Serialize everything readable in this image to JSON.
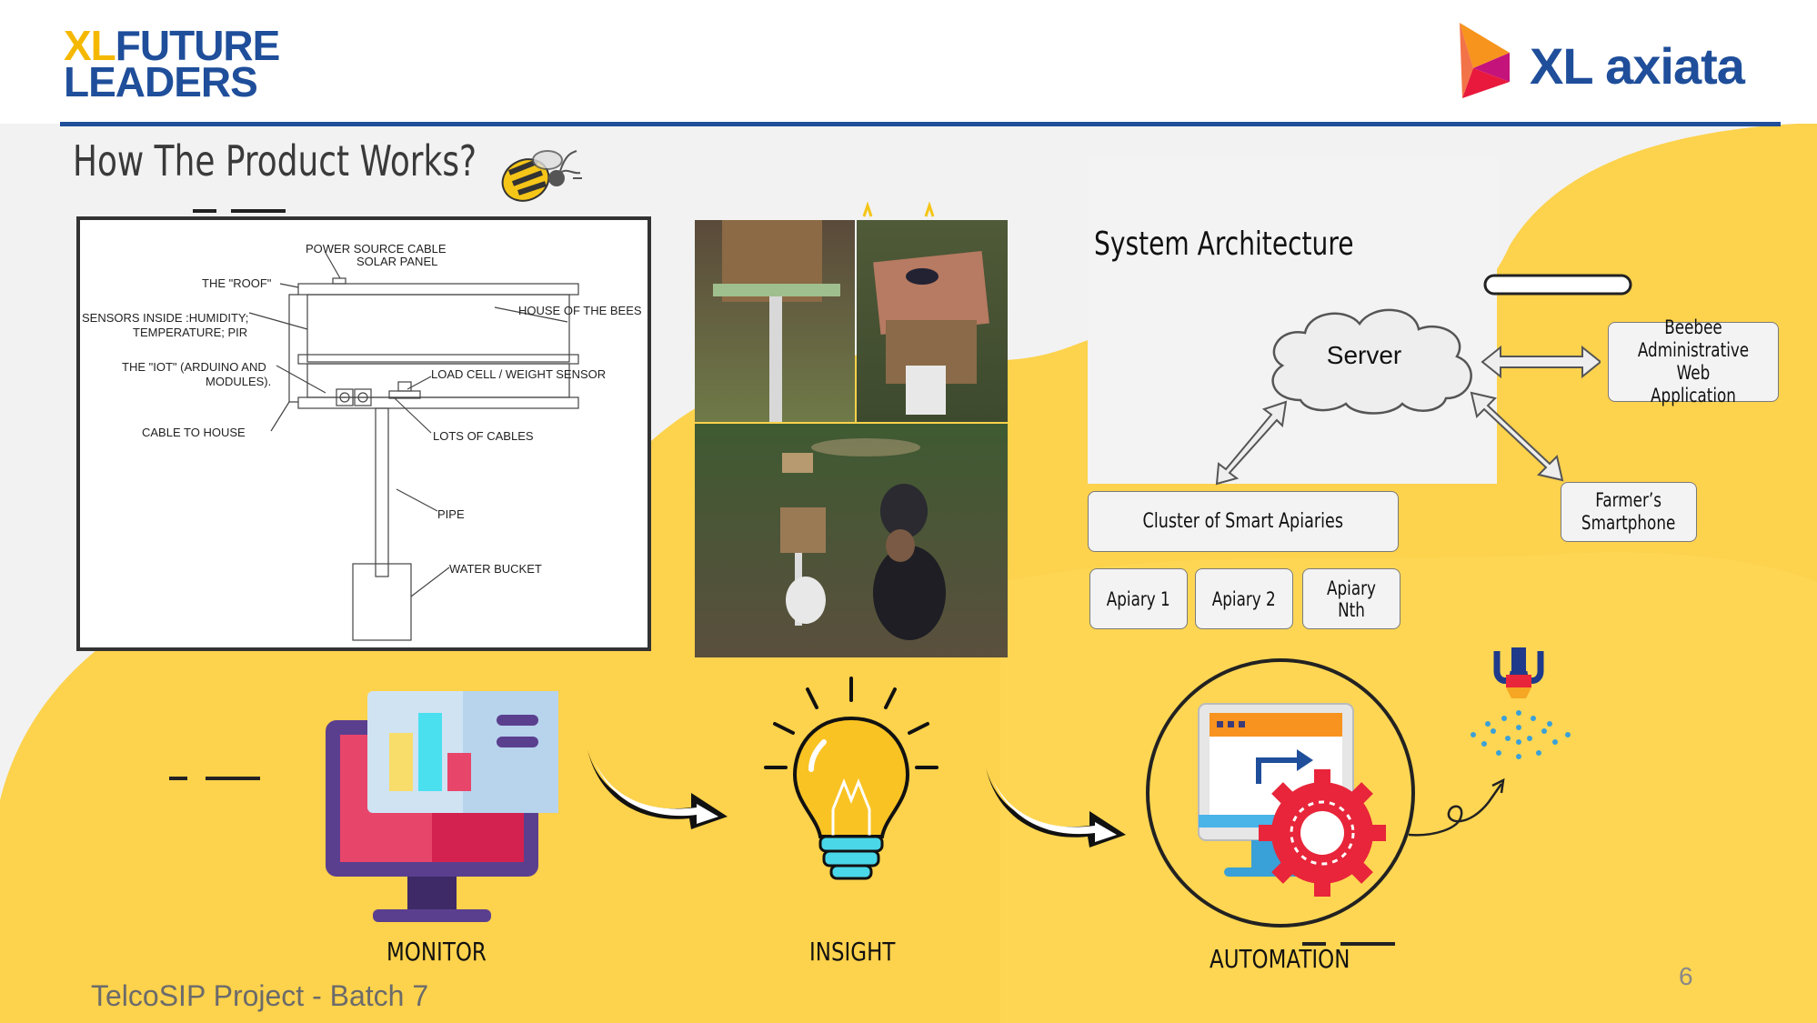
{
  "brand": {
    "left_part1": "XL",
    "left_part2": "FUTURE",
    "left_part3": "LEADERS",
    "right": "XL axiata"
  },
  "slide": {
    "title": "How The Product Works?",
    "footer": "TelcoSIP Project - Batch 7",
    "page_number": "6"
  },
  "hive_diagram": {
    "labels": {
      "power": "POWER SOURCE CABLE",
      "solar": "SOLAR PANEL",
      "roof": "THE \"ROOF\"",
      "sensors1": "SENSORS INSIDE :HUMIDITY;",
      "sensors2": "TEMPERATURE; PIR",
      "house": "HOUSE OF THE BEES",
      "iot1": "THE \"IOT\" (ARDUINO AND",
      "iot2": "MODULES).",
      "loadcell": "LOAD CELL / WEIGHT SENSOR",
      "cable": "CABLE TO HOUSE",
      "cables": "LOTS OF CABLES",
      "pipe": "PIPE",
      "bucket": "WATER BUCKET"
    }
  },
  "architecture": {
    "title": "System Architecture",
    "server": "Server",
    "web_app": [
      "Beebee",
      "Administrative Web",
      "Application"
    ],
    "smartphone": [
      "Farmer’s",
      "Smartphone"
    ],
    "cluster": "Cluster of Smart Apiaries",
    "apiaries": [
      "Apiary 1",
      "Apiary 2",
      "Apiary Nth"
    ]
  },
  "process": {
    "monitor": "MONITOR",
    "insight": "INSIGHT",
    "automation": "AUTOMATION"
  },
  "colors": {
    "brand_blue": "#1f4e9a",
    "brand_yellow": "#f5b800",
    "background_yellow": "#fdd24c",
    "accent_yellow": "#f9c323"
  }
}
